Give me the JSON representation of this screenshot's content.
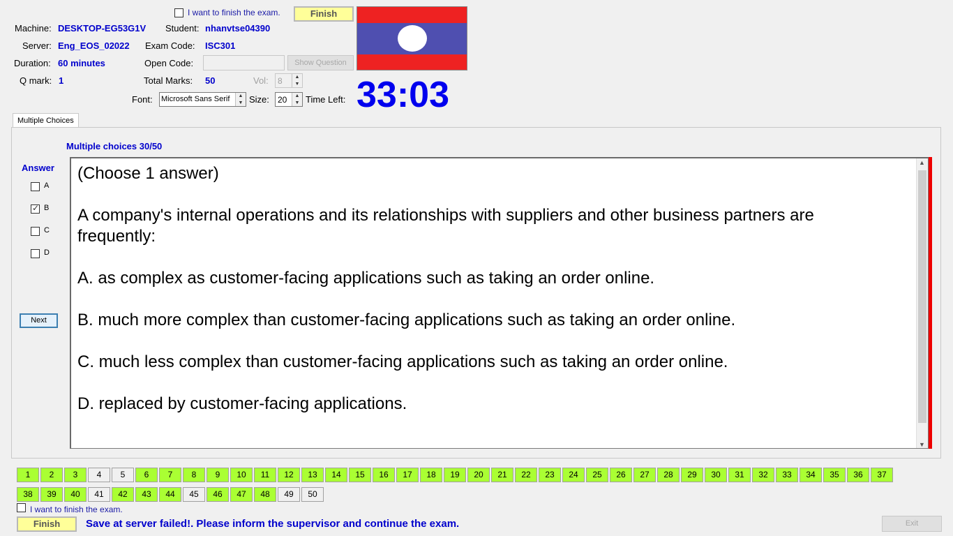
{
  "header": {
    "finish_check_label": "I want to finish the exam.",
    "finish_button_label": "Finish",
    "machine_label": "Machine:",
    "machine_value": "DESKTOP-EG53G1V",
    "student_label": "Student:",
    "student_value": "nhanvtse04390",
    "server_label": "Server:",
    "server_value": "Eng_EOS_02022",
    "exam_code_label": "Exam Code:",
    "exam_code_value": "ISC301",
    "duration_label": "Duration:",
    "duration_value": "60 minutes",
    "open_code_label": "Open Code:",
    "open_code_value": "",
    "show_question_label": "Show Question",
    "qmark_label": "Q mark:",
    "qmark_value": "1",
    "total_marks_label": "Total Marks:",
    "total_marks_value": "50",
    "vol_label": "Vol:",
    "vol_value": "8",
    "font_label": "Font:",
    "font_value": "Microsoft Sans Serif",
    "size_label": "Size:",
    "size_value": "20",
    "time_left_label": "Time Left:",
    "time_left_value": "33:03",
    "flag_colors": {
      "red": "#ee2222",
      "blue": "#4f4fb0",
      "white": "#ffffff"
    }
  },
  "tabs": [
    {
      "label": "Multiple Choices"
    }
  ],
  "question": {
    "progress": "Multiple choices 30/50",
    "answer_heading": "Answer",
    "options": [
      {
        "letter": "A",
        "checked": false
      },
      {
        "letter": "B",
        "checked": true
      },
      {
        "letter": "C",
        "checked": false
      },
      {
        "letter": "D",
        "checked": false
      }
    ],
    "next_label": "Next",
    "instruction": "(Choose 1 answer)",
    "text": "A company's internal operations and its relationships with suppliers and other business partners are frequently:",
    "choices": [
      "A.  as complex as customer-facing applications such as taking an order online.",
      "B.  much more complex than customer-facing applications such as taking an order online.",
      "C.  much less complex than customer-facing applications such as taking an order online.",
      "D.  replaced by customer-facing applications."
    ]
  },
  "question_grid": {
    "numbers": [
      "1",
      "2",
      "3",
      "4",
      "5",
      "6",
      "7",
      "8",
      "9",
      "10",
      "11",
      "12",
      "13",
      "14",
      "15",
      "16",
      "17",
      "18",
      "19",
      "20",
      "21",
      "22",
      "23",
      "24",
      "25",
      "26",
      "27",
      "28",
      "29",
      "30",
      "31",
      "32",
      "33",
      "34",
      "35",
      "36",
      "37",
      "38",
      "39",
      "40",
      "41",
      "42",
      "43",
      "44",
      "45",
      "46",
      "47",
      "48",
      "49",
      "50"
    ],
    "unanswered": [
      "4",
      "5",
      "41",
      "45",
      "49",
      "50"
    ],
    "answered_color": "#aaff33"
  },
  "footer": {
    "finish_check_label": "I want to finish the exam.",
    "finish_button_label": "Finish",
    "status_message": "Save at server failed!. Please inform the supervisor and continue the exam.",
    "exit_label": "Exit"
  }
}
